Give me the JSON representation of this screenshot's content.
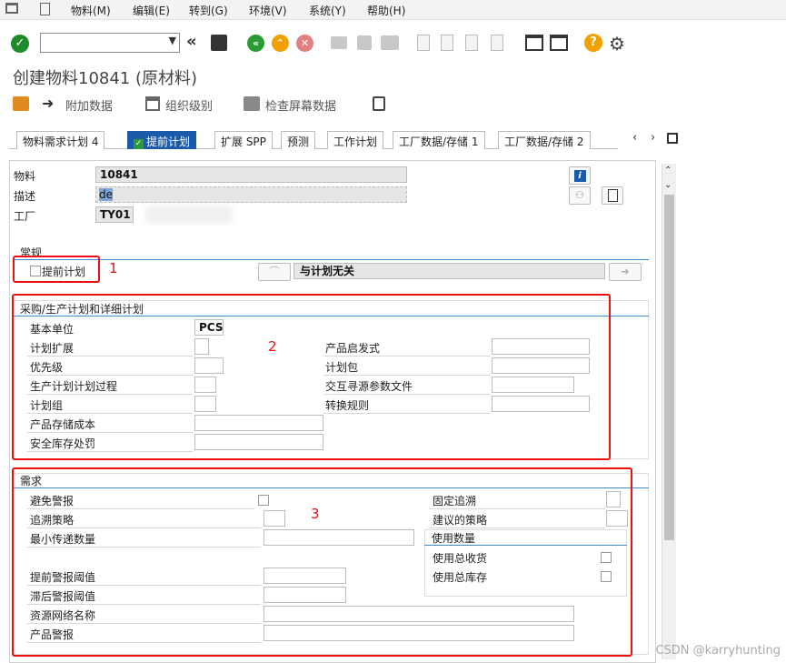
{
  "menu": {
    "items": [
      "物料(M)",
      "编辑(E)",
      "转到(G)",
      "环境(V)",
      "系统(Y)",
      "帮助(H)"
    ]
  },
  "window": {
    "title": "创建物料10841 (原材料)"
  },
  "app_toolbar": {
    "additional_data": "附加数据",
    "org_levels": "组织级别",
    "check_screen": "检查屏幕数据"
  },
  "tabs": {
    "t1": "物料需求计划 4",
    "t2": "提前计划",
    "t3": "扩展 SPP",
    "t4": "预测",
    "t5": "工作计划",
    "t6": "工厂数据/存储 1",
    "t7": "工厂数据/存储 2"
  },
  "header": {
    "material_label": "物料",
    "material_value": "10841",
    "desc_label": "描述",
    "desc_value": "de",
    "plant_label": "工厂",
    "plant_value": "TY01"
  },
  "general": {
    "title": "常规",
    "adv_plan_label": "提前计划",
    "plan_text": "与计划无关",
    "marker": "1"
  },
  "procurement": {
    "title": "采购/生产计划和详细计划",
    "marker": "2",
    "base_unit_label": "基本单位",
    "base_unit_value": "PCS",
    "plan_ext_label": "计划扩展",
    "priority_label": "优先级",
    "prod_plan_proc_label": "生产计划计划过程",
    "plan_group_label": "计划组",
    "storage_cost_label": "产品存储成本",
    "safety_penalty_label": "安全库存处罚",
    "heuristic_label": "产品启发式",
    "plan_pkg_label": "计划包",
    "interactive_label": "交互寻源参数文件",
    "conv_rule_label": "转换规则"
  },
  "demand": {
    "title": "需求",
    "marker": "3",
    "avoid_alert_label": "避免警报",
    "pegging_strategy_label": "追溯策略",
    "min_pass_qty_label": "最小传递数量",
    "early_alert_label": "提前警报阈值",
    "late_alert_label": "滞后警报阈值",
    "network_name_label": "资源网络名称",
    "product_alert_label": "产品警报",
    "fixed_pegging_label": "固定追溯",
    "proposed_strategy_label": "建议的策略",
    "usage_qty_title": "使用数量",
    "use_total_receipt_label": "使用总收货",
    "use_total_stock_label": "使用总库存"
  },
  "watermark": "CSDN @karryhunting",
  "colors": {
    "accent": "#1a5aa8",
    "highlight": "#e81010",
    "group_line": "#3d8bd0"
  }
}
